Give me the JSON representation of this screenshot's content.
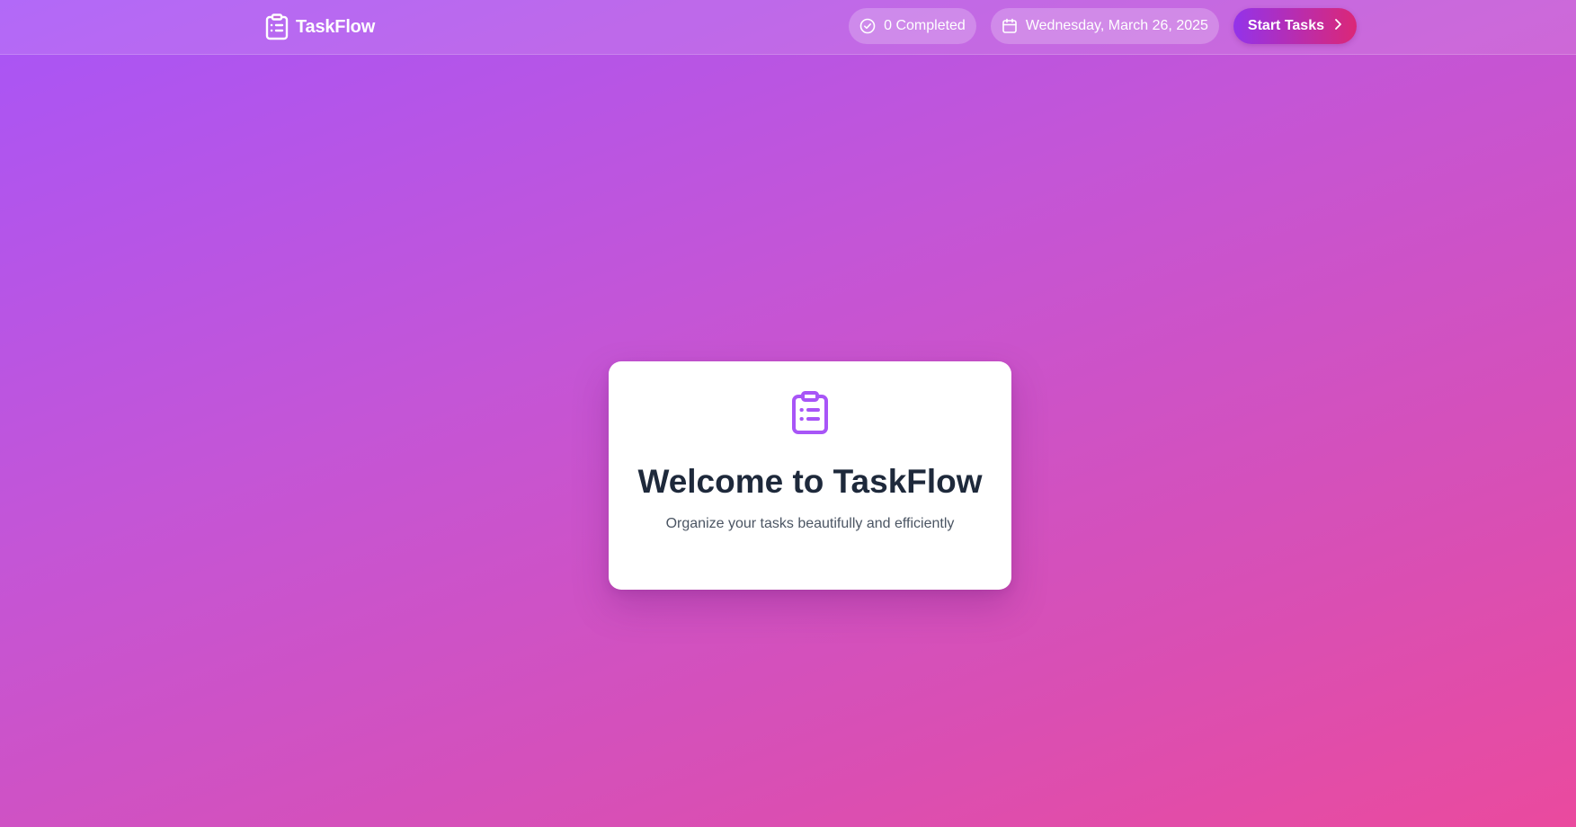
{
  "header": {
    "brand_name": "TaskFlow",
    "brand_icon": "clipboard-list-icon",
    "completed": {
      "icon": "check-circle-icon",
      "label": "0 Completed"
    },
    "date": {
      "icon": "calendar-icon",
      "label": "Wednesday, March 26, 2025"
    },
    "start_button": {
      "label": "Start Tasks",
      "icon": "chevron-right-icon"
    }
  },
  "welcome": {
    "icon": "clipboard-list-icon",
    "title": "Welcome to TaskFlow",
    "subtitle": "Organize your tasks beautifully and efficiently"
  },
  "colors": {
    "accent_purple": "#a855f7",
    "accent_pink": "#ec4899",
    "title_text": "#1e293b"
  }
}
